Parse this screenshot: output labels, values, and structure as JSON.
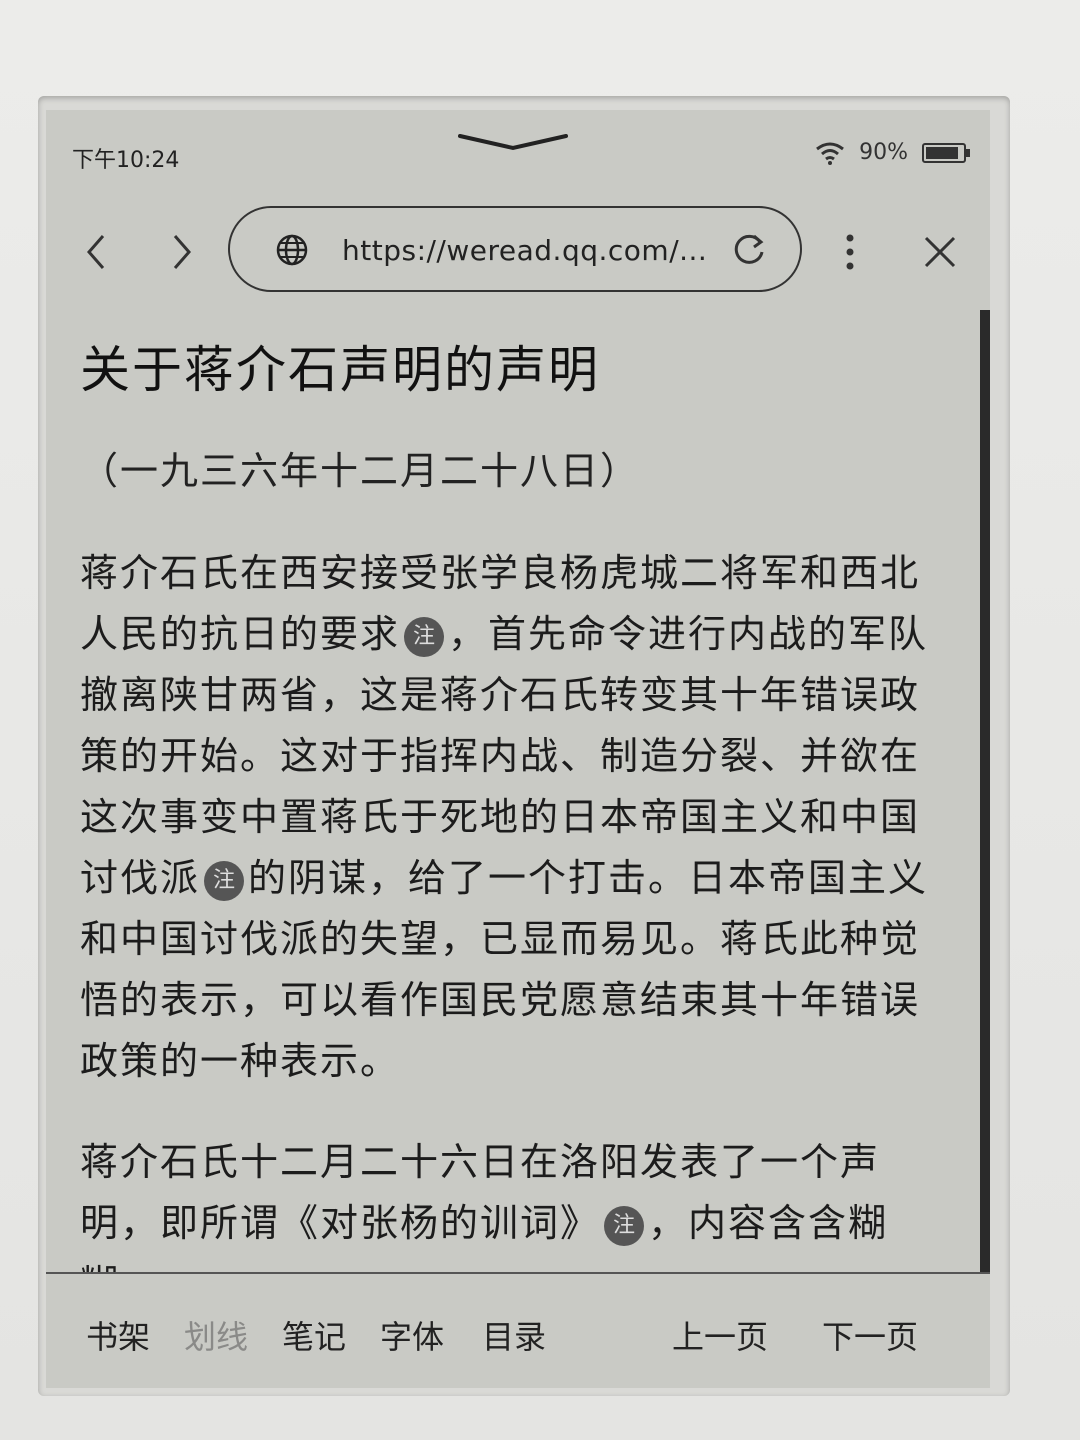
{
  "status": {
    "time": "下午10:24",
    "battery": "90%",
    "battery_level": 0.9
  },
  "browser": {
    "url": "https://weread.qq.com/..."
  },
  "article": {
    "title": "关于蒋介石声明的声明",
    "date": "（一九三六年十二月二十八日）",
    "p1_a": "蒋介石氏在西安接受张学良杨虎城二将军和西北人民的抗日的要求",
    "p1_b": "，首先命令进行内战的军队撤离陕甘两省，这是蒋介石氏转变其十年错误政策的开始。这对于指挥内战、制造分裂、并欲在这次事变中置蒋氏于死地的日本帝国主义和中国讨伐派",
    "p1_c": "的阴谋，给了一个打击。日本帝国主义和中国讨伐派的失望，已显而易见。蒋氏此种觉悟的表示，可以看作国民党愿意结束其十年错误政策的一种表示。",
    "p2_a": "蒋介石氏十二月二十六日在洛阳发表了一个声明，即所谓《对张杨的训词》",
    "p2_b": "，内容含含糊糊，",
    "note_label": "注"
  },
  "bottom_bar": {
    "bookshelf": "书架",
    "underline": "划线",
    "notes": "笔记",
    "font": "字体",
    "toc": "目录",
    "prev_page": "上一页",
    "next_page": "下一页"
  }
}
